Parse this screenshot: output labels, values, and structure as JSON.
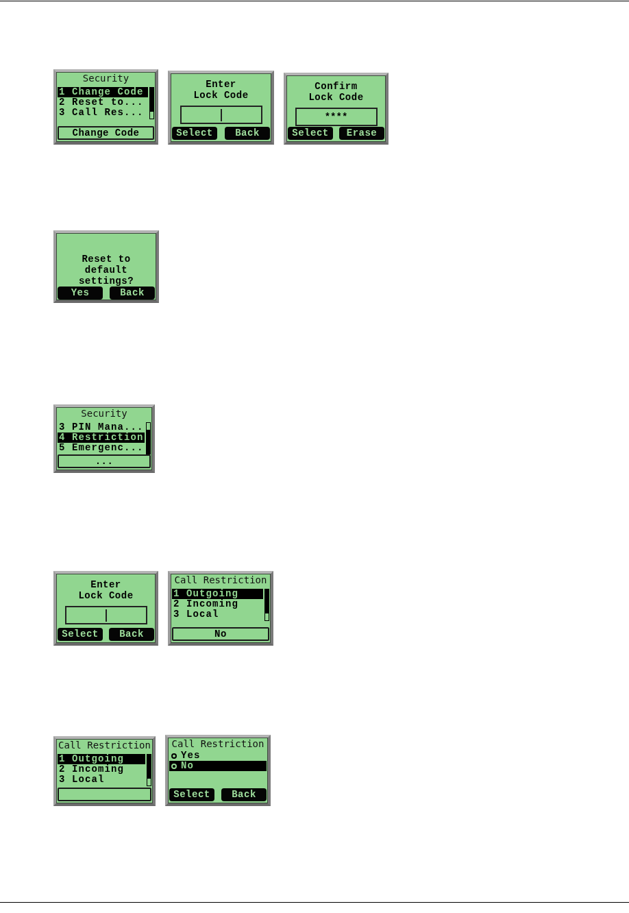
{
  "groups": [
    {
      "screens": [
        {
          "kind": "menu",
          "title": "Security",
          "items": [
            {
              "label": "1 Change Code",
              "selected": true
            },
            {
              "label": "2 Reset to...",
              "selected": false
            },
            {
              "label": "3 Call Res...",
              "selected": false
            }
          ],
          "scrolled_to_end": false,
          "footer": "Change Code"
        },
        {
          "kind": "prompt",
          "title": "Enter Lock Code",
          "input": {
            "cursor": true
          },
          "softkeys": [
            "Select",
            "Back"
          ]
        },
        {
          "kind": "prompt",
          "title": "Confirm Lock Code",
          "input": {
            "value": "****",
            "cursor": false
          },
          "softkeys": [
            "Select",
            "Erase"
          ]
        }
      ]
    },
    {
      "screens": [
        {
          "kind": "message",
          "text": "Reset to default settings?",
          "softkeys": [
            "Yes",
            "Back"
          ]
        }
      ]
    },
    {
      "screens": [
        {
          "kind": "menu",
          "title": "Security",
          "items": [
            {
              "label": "3 PIN Mana...",
              "selected": false
            },
            {
              "label": "4 Restriction",
              "selected": true
            },
            {
              "label": "5 Emergenc...",
              "selected": false
            }
          ],
          "scrolled_to_end": true,
          "footer": "..."
        }
      ]
    },
    {
      "screens": [
        {
          "kind": "prompt",
          "title": "Enter Lock Code",
          "input": {
            "cursor": true
          },
          "softkeys": [
            "Select",
            "Back"
          ]
        },
        {
          "kind": "menu",
          "title": "Call Restriction",
          "items": [
            {
              "label": "1 Outgoing",
              "selected": true
            },
            {
              "label": "2 Incoming",
              "selected": false
            },
            {
              "label": "3 Local",
              "selected": false
            }
          ],
          "scrolled_to_end": false,
          "footer": "No"
        }
      ]
    },
    {
      "screens": [
        {
          "kind": "menu",
          "title": "Call Restriction",
          "items": [
            {
              "label": "1 Outgoing",
              "selected": true
            },
            {
              "label": "2 Incoming",
              "selected": false
            },
            {
              "label": "3 Local",
              "selected": false
            }
          ],
          "scrolled_to_end": false
        },
        {
          "kind": "radio",
          "title": "Call Restriction",
          "options": [
            {
              "label": "Yes",
              "selected": false
            },
            {
              "label": "No",
              "selected": true
            }
          ],
          "softkeys": [
            "Select",
            "Back"
          ]
        }
      ]
    }
  ]
}
